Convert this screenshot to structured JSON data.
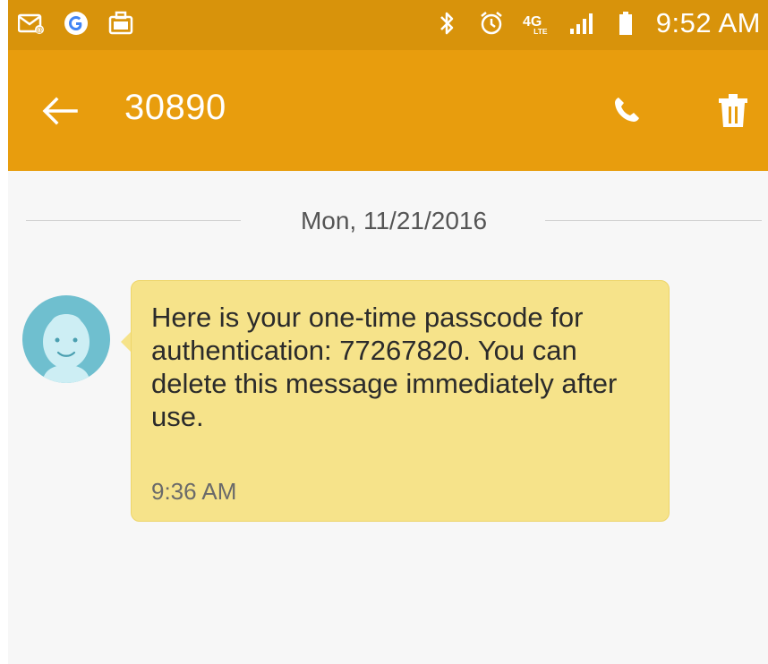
{
  "status_bar": {
    "left_icons": [
      "email-notification-icon",
      "google-icon",
      "media-notification-icon"
    ],
    "right_icons": [
      "bluetooth-icon",
      "alarm-icon",
      "4g-lte-icon",
      "signal-icon",
      "battery-icon"
    ],
    "time": "9:52 AM"
  },
  "app_bar": {
    "title": "30890",
    "icons": [
      "back-arrow-icon",
      "phone-icon",
      "trash-icon"
    ]
  },
  "conversation": {
    "date": "Mon, 11/21/2016",
    "messages": [
      {
        "text": "Here is your one-time passcode for authentication: 77267820. You can delete this message immediately after use.",
        "time": "9:36 AM"
      }
    ]
  },
  "colors": {
    "status_bar": "#d8930b",
    "app_bar": "#e89d0d",
    "bubble": "#f6e38a",
    "avatar": "#6fbfcf",
    "background": "#f7f7f7"
  }
}
